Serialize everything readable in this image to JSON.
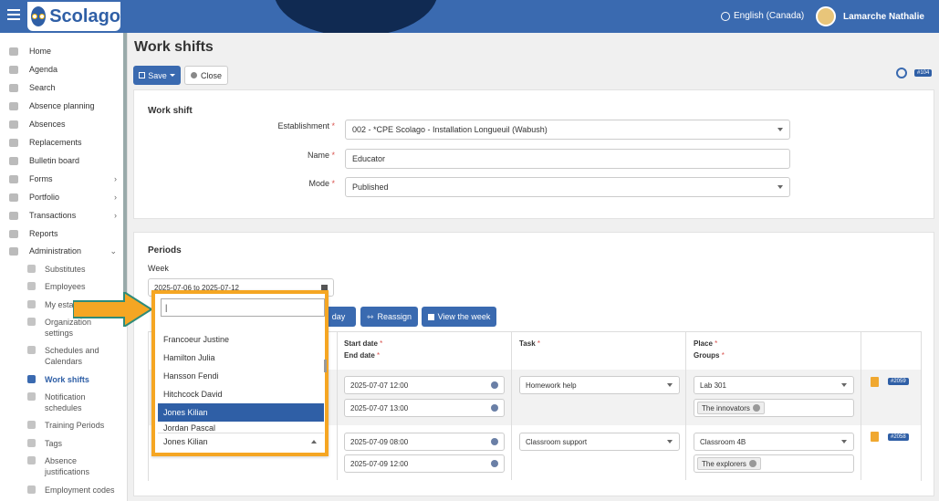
{
  "header": {
    "brand": "Scolago",
    "language": "English (Canada)",
    "user_name": "Lamarche Nathalie"
  },
  "sidebar": {
    "items": [
      {
        "label": "Home",
        "icon": "home-icon"
      },
      {
        "label": "Agenda",
        "icon": "calendar-icon"
      },
      {
        "label": "Search",
        "icon": "search-icon"
      },
      {
        "label": "Absence planning",
        "icon": "calendar-icon"
      },
      {
        "label": "Absences",
        "icon": "user-icon"
      },
      {
        "label": "Replacements",
        "icon": "replace-icon"
      },
      {
        "label": "Bulletin board",
        "icon": "board-icon"
      },
      {
        "label": "Forms",
        "icon": "form-icon",
        "chevron": "›"
      },
      {
        "label": "Portfolio",
        "icon": "trophy-icon",
        "chevron": "›"
      },
      {
        "label": "Transactions",
        "icon": "table-icon",
        "chevron": "›"
      },
      {
        "label": "Reports",
        "icon": "report-icon"
      },
      {
        "label": "Administration",
        "icon": "gear-icon",
        "chevron": "⌄"
      }
    ],
    "subitems": [
      {
        "label": "Substitutes"
      },
      {
        "label": "Employees"
      },
      {
        "label": "My esta"
      },
      {
        "label": "Organization settings"
      },
      {
        "label": "Schedules and Calendars"
      },
      {
        "label": "Work shifts"
      },
      {
        "label": "Notification schedules"
      },
      {
        "label": "Training Periods"
      },
      {
        "label": "Tags"
      },
      {
        "label": "Absence justifications"
      },
      {
        "label": "Employment codes"
      }
    ]
  },
  "page": {
    "title": "Work shifts",
    "save_label": "Save",
    "close_label": "Close",
    "record_id": "#104"
  },
  "work_shift": {
    "heading": "Work shift",
    "establishment_label": "Establishment",
    "establishment_value": "002 - *CPE Scolago - Installation Longueuil (Wabush)",
    "name_label": "Name",
    "name_value": "Educator",
    "mode_label": "Mode",
    "mode_value": "Published",
    "required": "*"
  },
  "periods": {
    "heading": "Periods",
    "week_label": "Week",
    "week_value": "2025-07-06 to 2025-07-12",
    "day_button": "day",
    "reassign_button": "Reassign",
    "view_week_button": "View the week",
    "columns": {
      "start_date": "Start date",
      "end_date": "End date",
      "task": "Task",
      "place": "Place",
      "groups": "Groups"
    },
    "rows": [
      {
        "start": "2025-07-07 12:00",
        "end": "2025-07-07 13:00",
        "task": "Homework help",
        "place": "Lab 301",
        "group": "The innovators",
        "id": "#2059"
      },
      {
        "start": "2025-07-09 08:00",
        "end": "2025-07-09 12:00",
        "task": "Classroom support",
        "place": "Classroom 4B",
        "group": "The explorers",
        "id": "#2058"
      }
    ]
  },
  "employee_dropdown": {
    "search_value": "|",
    "options": [
      "Francoeur Justine",
      "Hamilton Julia",
      "Hansson Fendi",
      "Hitchcock David",
      "Jones Kilian",
      "Jordan Pascal"
    ],
    "highlighted": "Jones Kilian",
    "selected_value": "Jones Kilian"
  },
  "colors": {
    "primary": "#3a6ab0",
    "highlight": "#f5a623",
    "arrow": "#f5a623"
  }
}
